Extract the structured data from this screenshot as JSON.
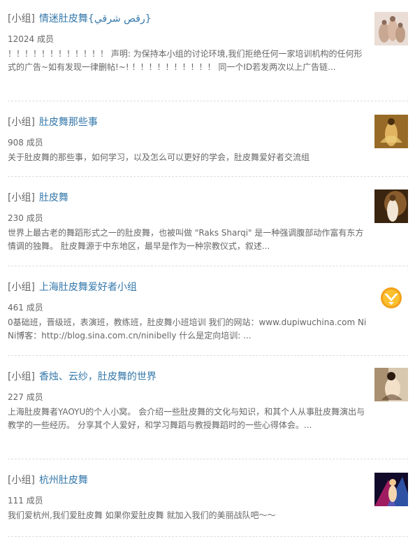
{
  "groups": [
    {
      "tag": "[小组]",
      "title": "情迷肚皮舞{رقص شرقي}",
      "members": "12024 成员",
      "desc": "！！！！！！！！！！！！ 声明: 为保持本小组的讨论环境,我们拒绝任何一家培训机构的任何形式的广告~如有发现一律删帖!~! ！！！！！！！！！！ 同一个ID若发两次以上广告链...",
      "thumb": "group-avatar-dancers-image"
    },
    {
      "tag": "[小组]",
      "title": "肚皮舞那些事",
      "members": "908 成员",
      "desc": "关于肚皮舞的那些事，如何学习，以及怎么可以更好的学会，肚皮舞爱好者交流组",
      "thumb": "group-avatar-dancer-golden-image"
    },
    {
      "tag": "[小组]",
      "title": "肚皮舞",
      "members": "230 成员",
      "desc": "世界上最古老的舞蹈形式之一的肚皮舞，也被叫做 \"Raks Sharqi\" 是一种强调腹部动作富有东方情调的独舞。 肚皮舞源于中东地区，最早是作为一种宗教仪式，叙述...",
      "thumb": "group-avatar-dancer-white-image"
    },
    {
      "tag": "[小组]",
      "title": "上海肚皮舞爱好者小组",
      "members": "461 成员",
      "desc": "0基础班，晋级班，表演班，教练班，肚皮舞小班培训 我们的网站：www.dupiwuchina.com NiNi博客：http://blog.sina.com.cn/ninibelly 什么是定向培训: ...",
      "thumb": "group-avatar-orange-logo-image"
    },
    {
      "tag": "[小组]",
      "title": "香烛、云纱，肚皮舞的世界",
      "members": "227 成员",
      "desc": "上海肚皮舞者YAOYU的个人小窝。 会介绍一些肚皮舞的文化与知识，和其个人从事肚皮舞演出与教学的一些经历。 分享其个人爱好，和学习舞蹈与教授舞蹈时的一些心得体会。...",
      "thumb": "group-avatar-dancer-portrait-image"
    },
    {
      "tag": "[小组]",
      "title": "杭州肚皮舞",
      "members": "111 成员",
      "desc": "我们爱杭州,我们爱肚皮舞 如果你爱肚皮舞 就加入我们的美丽战队吧～～",
      "thumb": "group-avatar-dancer-colorful-image"
    }
  ]
}
